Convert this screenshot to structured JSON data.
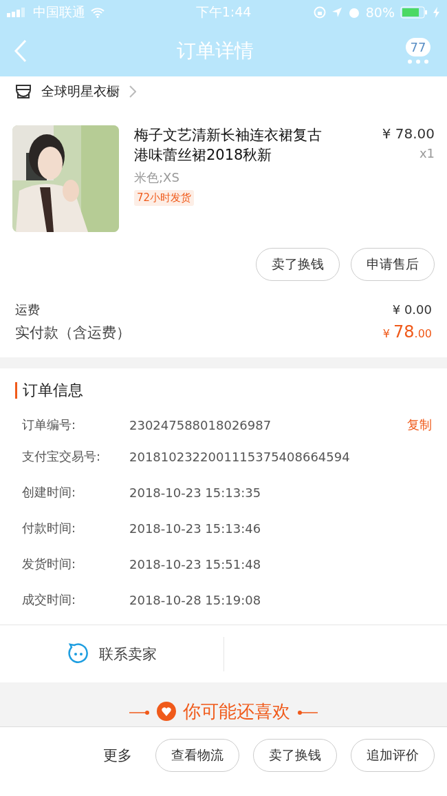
{
  "status_bar": {
    "carrier": "中国联通",
    "time": "下午1:44",
    "battery": "80%"
  },
  "nav": {
    "title": "订单详情",
    "badge": "77"
  },
  "shop": {
    "name": "全球明星衣橱"
  },
  "product": {
    "title": "梅子文艺清新长袖连衣裙复古港味蕾丝裙2018秋新",
    "sku": "米色;XS",
    "tag": "72小时发货",
    "price": "¥ 78.00",
    "quantity": "x1"
  },
  "item_actions": [
    "卖了换钱",
    "申请售后"
  ],
  "fees": {
    "shipping_label": "运费",
    "shipping_value": "¥ 0.00",
    "paid_label": "实付款（含运费）",
    "paid_currency": "¥",
    "paid_int": "78",
    "paid_dec": ".00"
  },
  "order_info": {
    "title": "订单信息",
    "copy": "复制",
    "rows": [
      {
        "label": "订单编号:",
        "value": "230247588018026987"
      },
      {
        "label": "支付宝交易号:",
        "value": "2018102322001115375408664594"
      },
      {
        "label": "创建时间:",
        "value": "2018-10-23 15:13:35"
      },
      {
        "label": "付款时间:",
        "value": "2018-10-23 15:13:46"
      },
      {
        "label": "发货时间:",
        "value": "2018-10-23 15:51:48"
      },
      {
        "label": "成交时间:",
        "value": "2018-10-28 15:19:08"
      }
    ]
  },
  "contact": {
    "label": "联系卖家"
  },
  "recommend": {
    "title": "你可能还喜欢"
  },
  "bottom_bar": {
    "more": "更多",
    "buttons": [
      "查看物流",
      "卖了换钱",
      "追加评价"
    ]
  }
}
